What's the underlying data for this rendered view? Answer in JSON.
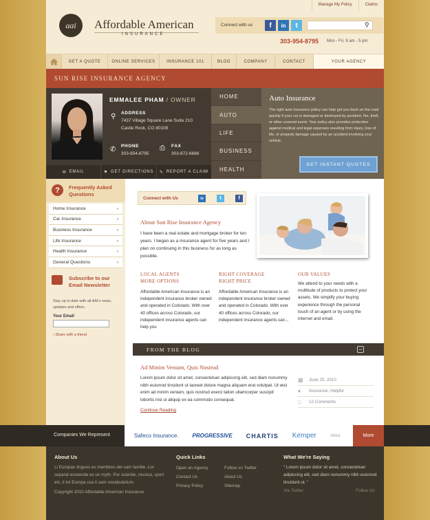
{
  "header": {
    "top_links": [
      "Manage My Policy",
      "Claims"
    ],
    "logo_mark": "aai",
    "logo_main": "Affordable American",
    "logo_sub": "INSURANCE",
    "connect_label": "Connect with us",
    "phone": "303-954-8795",
    "hours": "Mon - Fri, 9 am - 5 pm"
  },
  "nav": {
    "items": [
      "GET A QUOTE",
      "ONLINE SERVICES",
      "INSURANCE 101",
      "BLOG",
      "COMPANY",
      "CONTACT",
      "YOUR AGENCY"
    ]
  },
  "agency": {
    "name": "SUN RISE INSURANCE AGENCY",
    "agent_name": "EMMALEE PHAM",
    "agent_role": " / OWNER",
    "address_label": "ADDRESS",
    "address_line1": "7437 Village Square Lane Suite 210",
    "address_line2": "Castle Rock, CO 80108",
    "phone_label": "PHONE",
    "phone": "303-954-8795",
    "fax_label": "FAX",
    "fax": "303-872-6666",
    "actions": [
      "EMAIL",
      "GET DIRECTIONS",
      "REPORT A CLAIM"
    ],
    "menu": [
      "HOME",
      "AUTO",
      "LIFE",
      "BUSINESS",
      "HEALTH"
    ]
  },
  "auto": {
    "title": "Auto Insurance",
    "text": "The right auto insurance policy can help get you back on the road quickly if your car is damaged or destroyed by accident, fire, theft, or other covered event. Your policy also provides protection against medical and legal expenses resulting from injury, loss of life, or property damage caused by an accident involving your vehicle.",
    "button": "GET INSTANT QUOTES"
  },
  "faq": {
    "title": "Frequently Asked Questions",
    "items": [
      "Home Insurance",
      "Car Insurance",
      "Business Insurance",
      "Life Insurance",
      "Health Insurance",
      "General Questions"
    ]
  },
  "newsletter": {
    "title": "Subscribe to our Email Newsletter",
    "text": "Stay up to date with all AAI's news, updates and offers.",
    "email_label": "Your Email",
    "share": "Share with a friend"
  },
  "main": {
    "connect_label": "Connect with Us",
    "about_title": "About Sun Rise Insurance Agency",
    "about_text": "I have been a real estate and mortgage broker for ten years. I began as a insurance agent for five years and I plan on continuing in this business for as long as possible.",
    "columns": [
      {
        "title1": "LOCAL AGENTS",
        "title2": "MORE OPTIONS",
        "text": "Affordable American Insurance is an independent insurance broker owned and operated in Colorado. With over 40 offices across Colorado, our independent insurance agents can help you"
      },
      {
        "title1": "RIGHT COVERAGE",
        "title2": "RIGHT PRICE",
        "text": "Affordable American Insurance is an independent insurance broker owned and operated in Colorado. With over 40 offices across Colorado, our independent insurance agents can..."
      },
      {
        "title1": "OUR VALUES",
        "title2": "",
        "text": "We attend to your needs with a multitude of products to protect your assets. We simplify your buying experience through the personal touch of an agent or by using the internet and email."
      }
    ],
    "blog_title": "FROM THE BLOG",
    "post": {
      "title": "Ad Minim Veniam, Quis Nostrud",
      "text": "Lorem ipsum dolor sit amet, consectetuer adipiscing elit, sed diam nonummy nibh euismod tincidunt ut laoreet dolore magna aliquam erat volutpat. Ut wisi enim ad minim veniam, quis nostrud exerci tation ullamcorper suscipit lobortis nisl ut aliquip ex ea commodo consequat.",
      "more": "Continue Reading",
      "date": "June 25, 2010",
      "tags": "Insurance, Helpful",
      "comments": "12 Comments"
    }
  },
  "companies": {
    "label": "Companies We Represent",
    "logos": [
      "Safeco Insurance.",
      "PROGRESSIVE",
      "CHARTIS",
      "Kemper",
      "Allied"
    ],
    "more": "More"
  },
  "footer": {
    "about_title": "About Us",
    "about_text": "Li Europan lingues es membres del sam familie. Lor separat existentie es un myth. Por scientie, musica, sport etc, li tot Europa usa li sam vocabularium.",
    "copyright": "Copyright 2010 Affordable American Insurance.",
    "links_title": "Quick Links",
    "links_col1": [
      "Open an Agency",
      "Contact Us",
      "Privacy Policy"
    ],
    "links_col2": [
      "Follow on Twitter",
      "About Us",
      "Sitemap"
    ],
    "saying_title": "What We're Saying",
    "quote": "Lorem ipsum dolor sit amet, consectetuer adipiscing elit, sed diam nonummy nibh euismod tincidunt ut.",
    "via": "Via Twitter",
    "follow": "Follow Us"
  },
  "colors": {
    "accent": "#b04a30",
    "dark": "#433b31",
    "cream": "#f6ecd6",
    "gold": "#c9a24a"
  }
}
